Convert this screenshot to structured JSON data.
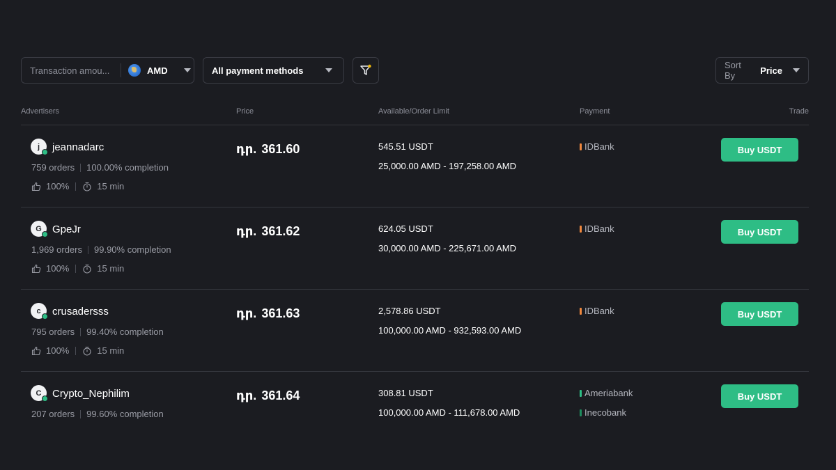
{
  "filters": {
    "amount_placeholder": "Transaction amou...",
    "currency": "AMD",
    "currency_icon": "armenia-flag-icon",
    "payment_method": "All payment methods",
    "filter_icon": "filter-icon",
    "sort_label": "Sort By",
    "sort_value": "Price"
  },
  "table": {
    "headers": {
      "advertisers": "Advertisers",
      "price": "Price",
      "available": "Available/Order Limit",
      "payment": "Payment",
      "trade": "Trade"
    },
    "rows": [
      {
        "avatar_letter": "j",
        "name": "jeannadarc",
        "orders": "759 orders",
        "completion": "100.00% completion",
        "rating": "100%",
        "time": "15 min",
        "price_symbol": "դր.",
        "price": "361.60",
        "available": "545.51 USDT",
        "limit": "25,000.00 AMD - 197,258.00 AMD",
        "payments": [
          {
            "name": "IDBank",
            "color": "#f0883e"
          }
        ],
        "button": "Buy USDT"
      },
      {
        "avatar_letter": "G",
        "name": "GpeJr",
        "orders": "1,969 orders",
        "completion": "99.90% completion",
        "rating": "100%",
        "time": "15 min",
        "price_symbol": "դր.",
        "price": "361.62",
        "available": "624.05 USDT",
        "limit": "30,000.00 AMD - 225,671.00 AMD",
        "payments": [
          {
            "name": "IDBank",
            "color": "#f0883e"
          }
        ],
        "button": "Buy USDT"
      },
      {
        "avatar_letter": "c",
        "name": "crusadersss",
        "orders": "795 orders",
        "completion": "99.40% completion",
        "rating": "100%",
        "time": "15 min",
        "price_symbol": "դր.",
        "price": "361.63",
        "available": "2,578.86 USDT",
        "limit": "100,000.00 AMD - 932,593.00 AMD",
        "payments": [
          {
            "name": "IDBank",
            "color": "#f0883e"
          }
        ],
        "button": "Buy USDT"
      },
      {
        "avatar_letter": "C",
        "name": "Crypto_Nephilim",
        "orders": "207 orders",
        "completion": "99.60% completion",
        "price_symbol": "դր.",
        "price": "361.64",
        "available": "308.81 USDT",
        "limit": "100,000.00 AMD - 111,678.00 AMD",
        "payments": [
          {
            "name": "Ameriabank",
            "color": "#2ebd85"
          },
          {
            "name": "Inecobank",
            "color": "#1e8c5e"
          }
        ],
        "button": "Buy USDT"
      }
    ]
  },
  "colors": {
    "background": "#1b1c21",
    "accent": "#2ebd85",
    "border": "#3a3c44"
  }
}
